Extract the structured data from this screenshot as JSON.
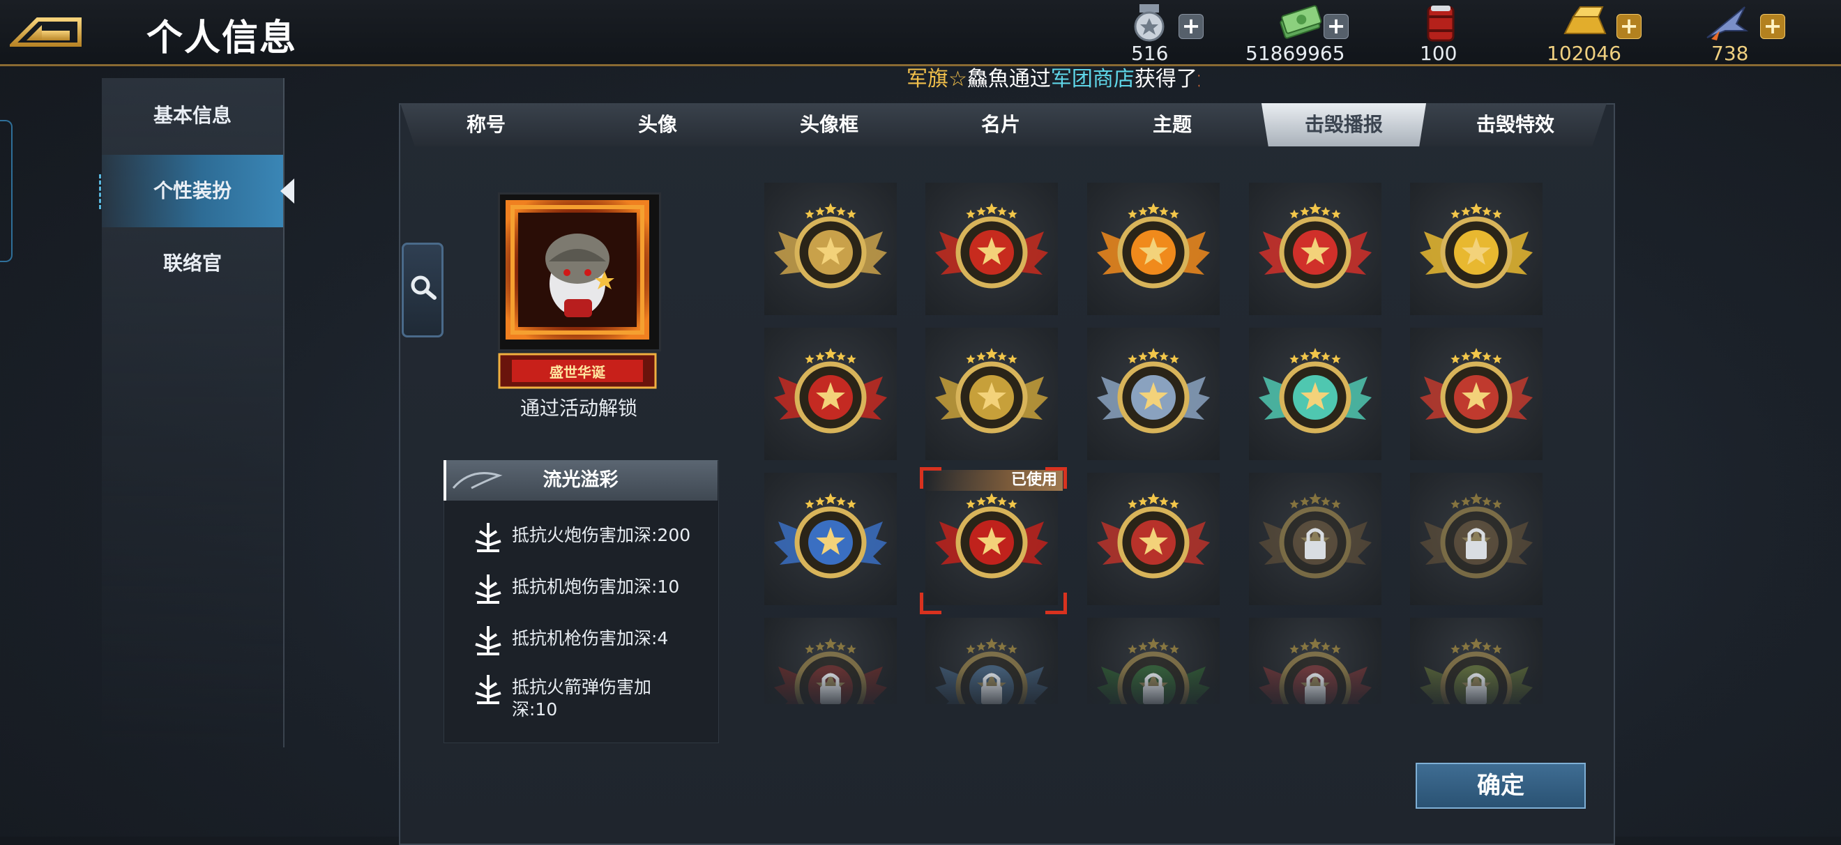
{
  "header": {
    "title": "个人信息"
  },
  "resources": [
    {
      "name": "medal",
      "icon": "medal-icon",
      "value": "516",
      "color": "#e6a870"
    },
    {
      "name": "cash",
      "icon": "cash-icon",
      "value": "51869965",
      "color": "#e8edf2"
    },
    {
      "name": "fuel",
      "icon": "fuel-barrel-icon",
      "value": "100",
      "color": "#e8edf2"
    },
    {
      "name": "gold",
      "icon": "gold-bar-icon",
      "value": "102046",
      "color": "#f0d080"
    },
    {
      "name": "jet",
      "icon": "jet-icon",
      "value": "738",
      "color": "#f0d080"
    }
  ],
  "ticker": {
    "part1": "军旗☆",
    "part2": "鱻魚",
    "part3": "通过",
    "part4": "军团商店",
    "part5": "获得了",
    "part6": "辶"
  },
  "sidebar": {
    "items": [
      {
        "label": "基本信息"
      },
      {
        "label": "个性装扮"
      },
      {
        "label": "联络官"
      }
    ]
  },
  "tabs": [
    {
      "label": "称号"
    },
    {
      "label": "头像"
    },
    {
      "label": "头像框"
    },
    {
      "label": "名片"
    },
    {
      "label": "主题"
    },
    {
      "label": "击毁播报",
      "active": true
    },
    {
      "label": "击毁特效"
    }
  ],
  "preview": {
    "banner_text": "盛世华诞",
    "unlock_text": "通过活动解锁"
  },
  "attributes": {
    "title": "流光溢彩",
    "items": [
      {
        "text": "抵抗火炮伤害加深:200"
      },
      {
        "text": "抵抗机炮伤害加深:10"
      },
      {
        "text": "抵抗机枪伤害加深:4"
      },
      {
        "text": "抵抗火箭弹伤害加深:10"
      }
    ]
  },
  "badges": {
    "used_label": "已使用",
    "rows": [
      [
        {
          "icon": "star-shield-badge-icon",
          "locked": false,
          "accent": "#c9a14a"
        },
        {
          "icon": "winged-sword-badge-icon",
          "locked": false,
          "accent": "#c72b1e"
        },
        {
          "icon": "pumpkin-badge-icon",
          "locked": false,
          "accent": "#f08a1c"
        },
        {
          "icon": "red-star-wings-badge-icon",
          "locked": false,
          "accent": "#d0302a"
        },
        {
          "icon": "lightning-wings-badge-icon",
          "locked": false,
          "accent": "#e8b830"
        }
      ],
      [
        {
          "icon": "lantern-badge-icon",
          "locked": false,
          "accent": "#c42a22"
        },
        {
          "icon": "treasure-chest-badge-icon",
          "locked": false,
          "accent": "#c7a03a"
        },
        {
          "icon": "robot-helmet-badge-icon",
          "locked": false,
          "accent": "#8aa2bf"
        },
        {
          "icon": "jade-ring-badge-icon",
          "locked": false,
          "accent": "#4fc7b0"
        },
        {
          "icon": "red-star-crest-badge-icon",
          "locked": false,
          "accent": "#c03a2e"
        }
      ],
      [
        {
          "icon": "shield-star-blue-badge-icon",
          "locked": false,
          "accent": "#3a6fc2"
        },
        {
          "icon": "red-banner-star-badge-icon",
          "locked": false,
          "accent": "#c0221c",
          "used": true
        },
        {
          "icon": "number-seven-badge-icon",
          "locked": false,
          "accent": "#b8322a"
        },
        {
          "icon": "book-lock-badge-icon",
          "locked": true,
          "accent": "#8a6a40"
        },
        {
          "icon": "crest-lock-badge-icon",
          "locked": true,
          "accent": "#8a6a40"
        }
      ],
      [
        {
          "icon": "locked-badge-icon",
          "locked": true,
          "accent": "#a0302a"
        },
        {
          "icon": "locked-badge-icon",
          "locked": true,
          "accent": "#5a8ab8"
        },
        {
          "icon": "locked-badge-icon",
          "locked": true,
          "accent": "#3a8a3a"
        },
        {
          "icon": "locked-badge-icon",
          "locked": true,
          "accent": "#b04040"
        },
        {
          "icon": "locked-badge-icon",
          "locked": true,
          "accent": "#8aa040"
        }
      ]
    ]
  },
  "confirm_label": "确定"
}
